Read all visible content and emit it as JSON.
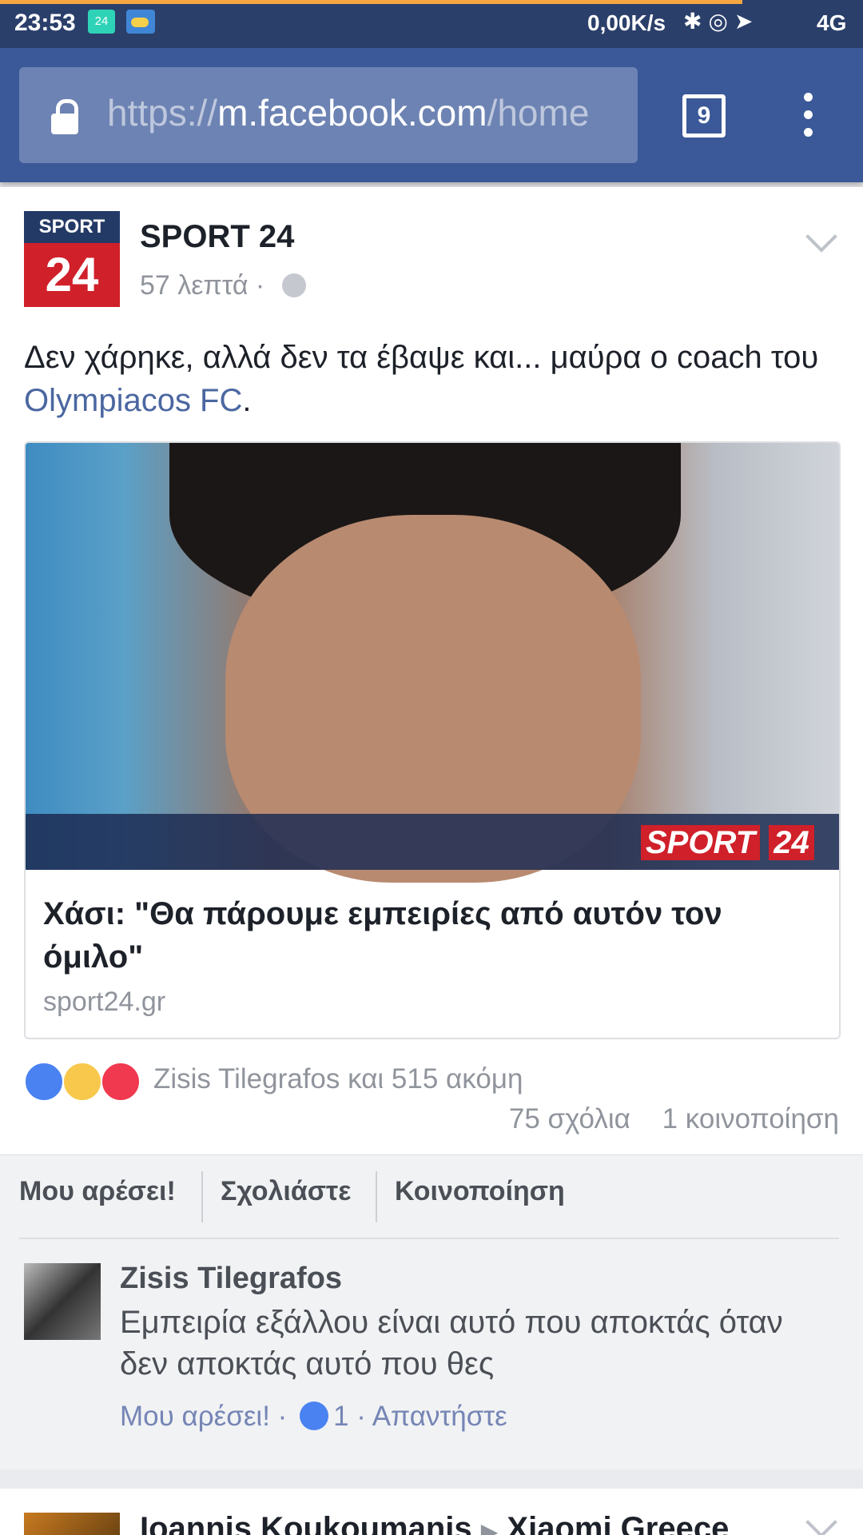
{
  "status_bar": {
    "time": "23:53",
    "app_badge": "24",
    "network_speed": "0,00K/s",
    "icons": [
      "bluetooth-icon",
      "rotation-lock-icon",
      "location-icon",
      "signal-icon"
    ],
    "network_type": "4G",
    "load_progress_pct": 86,
    "colors": {
      "background": "#2b3f6b",
      "progress": "#f4a640"
    }
  },
  "browser": {
    "url_scheme": "https://",
    "url_host": "m.facebook.com",
    "url_path": "/home",
    "tab_count": "9",
    "colors": {
      "toolbar": "#3b5998",
      "urlbox": "#6d83b3"
    }
  },
  "post": {
    "page_logo_top": "SPORT",
    "page_logo_bottom": "24",
    "page_name": "SPORT 24",
    "time": "57 λεπτά ·",
    "text_before_link": "Δεν χάρηκε, αλλά δεν τα έβαψε και... μαύρα ο coach του ",
    "link_text": "Olympiacos FC",
    "text_after_link": ".",
    "preview": {
      "watermark_a": "SPORT",
      "watermark_b": "24",
      "title": "Χάσι: \"Θα πάρουμε εμπειρίες από αυτόν τον όμιλο\"",
      "domain": "sport24.gr"
    },
    "reactions_text": "Zisis Tilegrafos και 515 ακόμη",
    "comments_count": "75 σχόλια",
    "shares_count": "1 κοινοποίηση",
    "actions": {
      "like": "Μου αρέσει!",
      "comment": "Σχολιάστε",
      "share": "Κοινοποίηση"
    }
  },
  "comment": {
    "author": "Zisis Tilegrafos",
    "text": "Εμπειρία εξάλλου είναι αυτό που αποκτάς όταν δεν αποκτάς αυτό που θες",
    "like_link": "Μου αρέσει! ·",
    "like_count": "1",
    "reply_link": "· Απαντήστε"
  },
  "next_post": {
    "author": "Ioannis Koukoumanis",
    "target": "Xiaomi Greece"
  }
}
